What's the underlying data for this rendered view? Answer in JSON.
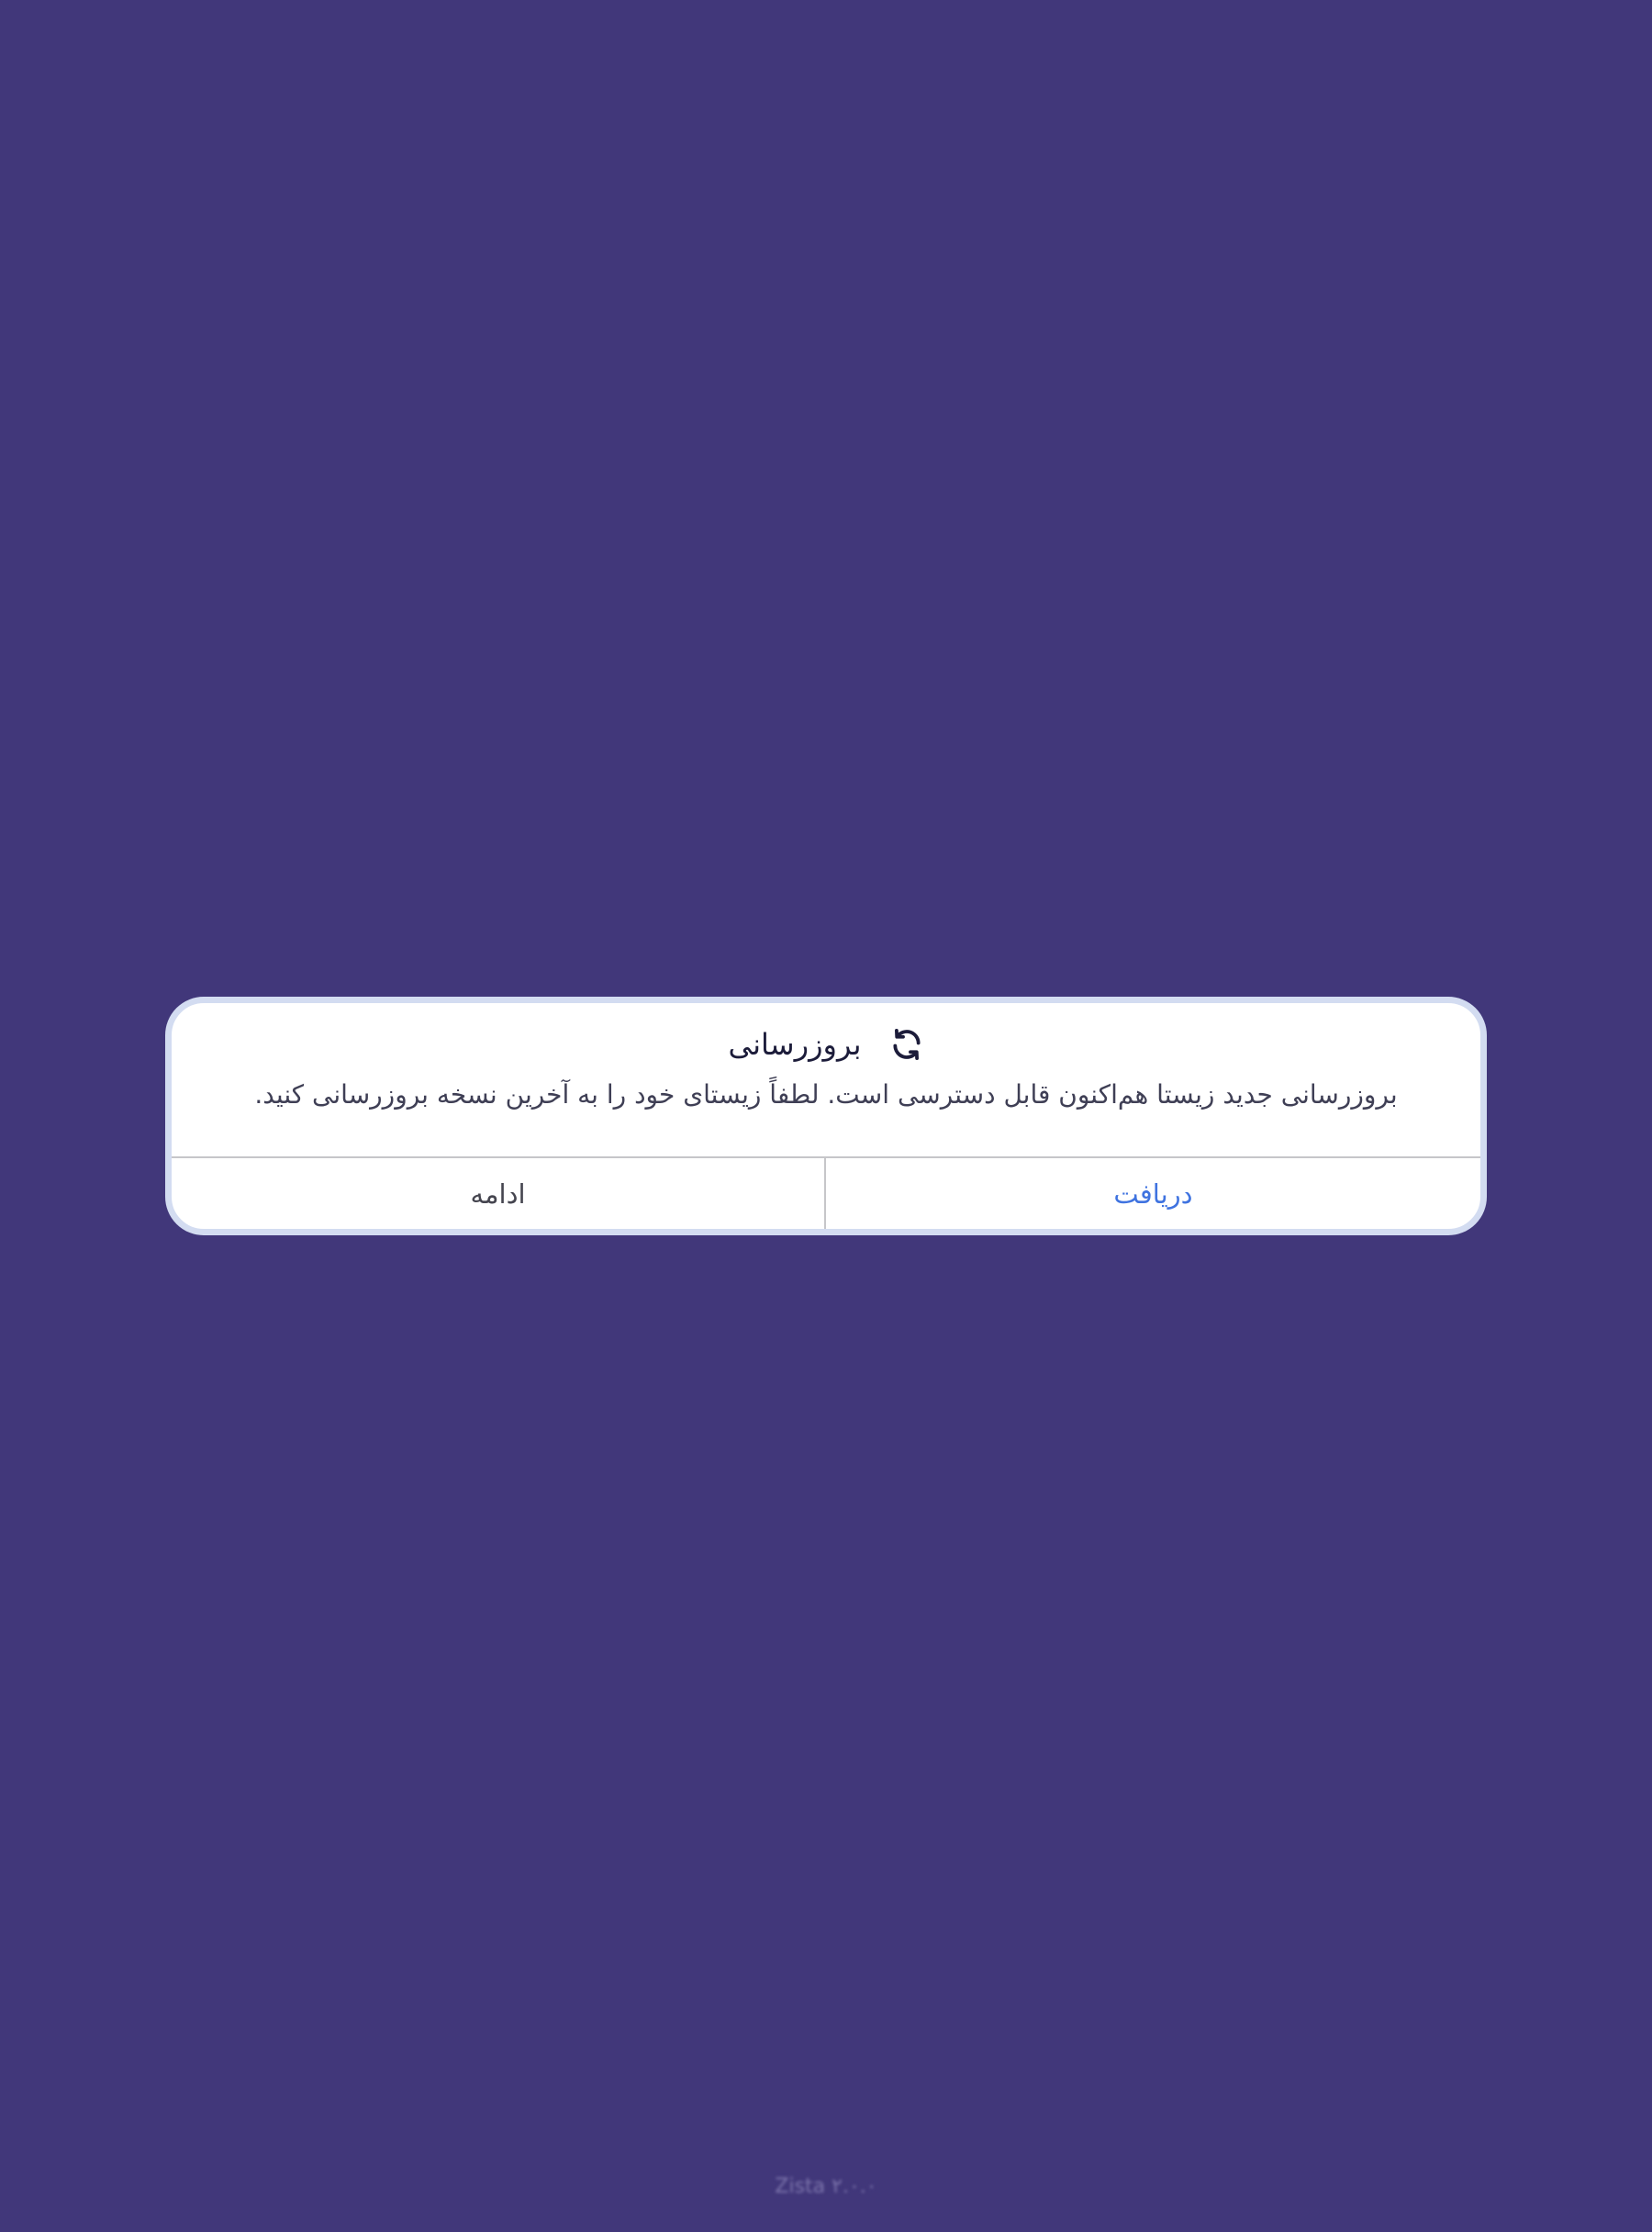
{
  "background_color": "#41377a",
  "dialog": {
    "title": "بروزرسانی",
    "title_icon": "refresh-icon",
    "message": "بروزرسانی جدید زیستا هم‌اکنون قابل دسترسی است. لطفاً زیستای خود را به آخرین نسخه بروزرسانی کنید.",
    "buttons": {
      "download_label": "دریافت",
      "continue_label": "ادامه"
    },
    "accent_color": "#3f73e0"
  },
  "footer": {
    "version_text": "Zista ۲.۰.۰"
  }
}
